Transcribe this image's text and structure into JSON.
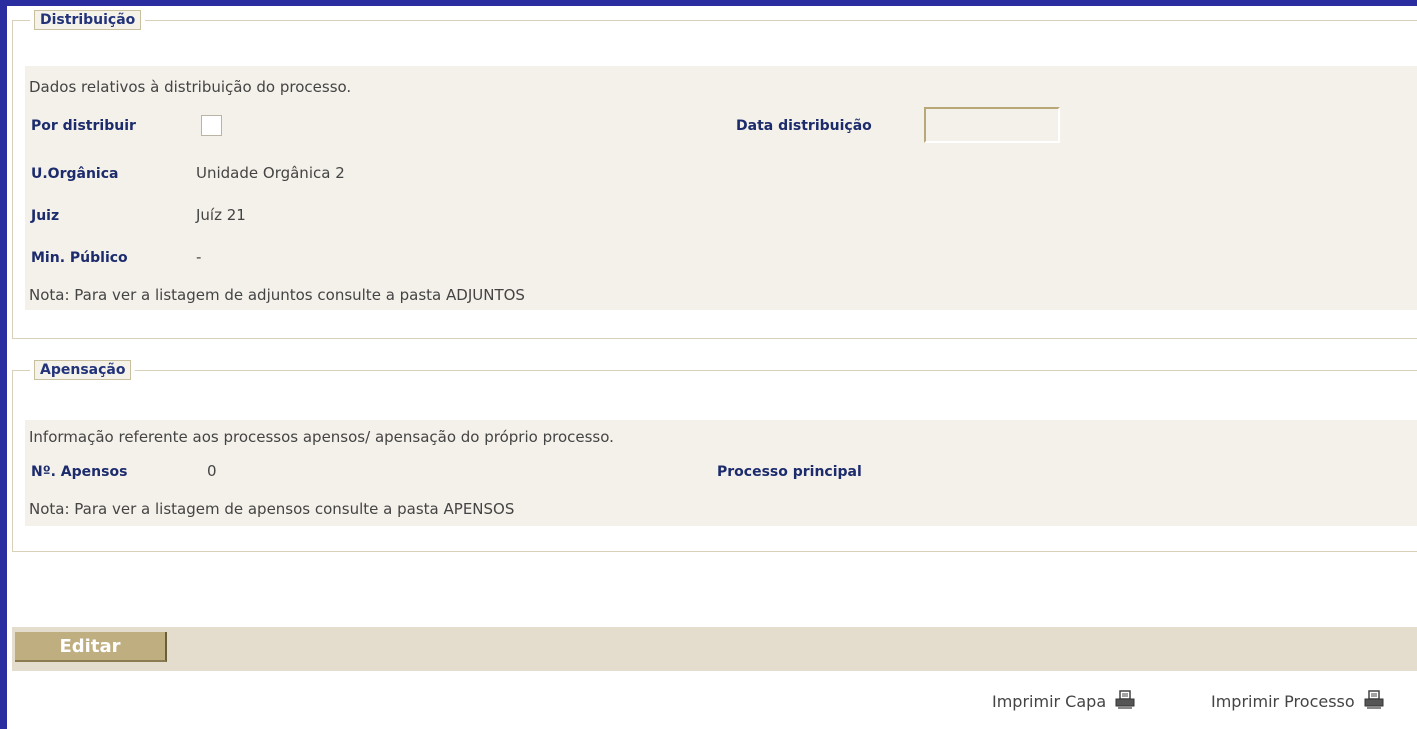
{
  "distribuicao": {
    "legend": "Distribuição",
    "description": "Dados relativos à distribuição do processo.",
    "por_distribuir_label": "Por distribuir",
    "por_distribuir_checked": false,
    "data_distribuicao_label": "Data distribuição",
    "data_distribuicao_value": "",
    "unidade_organica_label": "U.Orgânica",
    "unidade_organica_value": "Unidade Orgânica 2",
    "juiz_label": "Juiz",
    "juiz_value": "Juíz 21",
    "min_publico_label": "Min. Público",
    "min_publico_value": "-",
    "note": "Nota: Para ver a listagem de adjuntos consulte a pasta ADJUNTOS"
  },
  "apensacao": {
    "legend": "Apensação",
    "description": "Informação referente aos processos apensos/ apensação do próprio processo.",
    "n_apensos_label": "Nº. Apensos",
    "n_apensos_value": "0",
    "processo_principal_label": "Processo principal",
    "processo_principal_value": "",
    "note": "Nota: Para ver a listagem de apensos consulte a pasta APENSOS"
  },
  "toolbar": {
    "edit_label": "Editar"
  },
  "print": {
    "capa_label": "Imprimir Capa",
    "processo_label": "Imprimir Processo"
  },
  "icons": {
    "print": "printer-icon"
  },
  "colors": {
    "frame_border": "#2a2da0",
    "label_blue": "#1c2b6c",
    "panel_bg": "#f4f1ea",
    "button_bg": "#bfae80"
  }
}
